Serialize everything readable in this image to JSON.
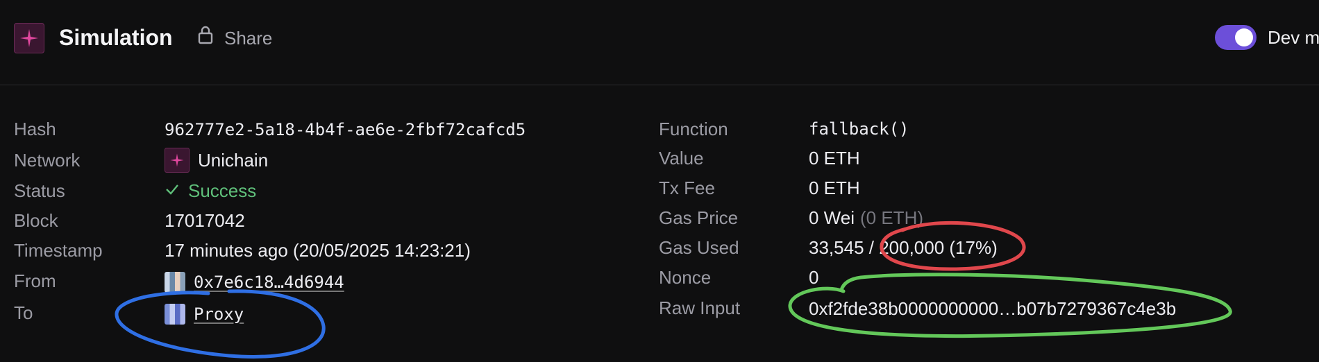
{
  "header": {
    "title": "Simulation",
    "share_label": "Share",
    "dev_mode_label": "Dev m",
    "dev_mode_on": true
  },
  "colors": {
    "accent": "#6c4fd9",
    "brand": "#e0479e",
    "success": "#5fbf7a",
    "annotation_blue": "#2f6fe4",
    "annotation_red": "#e0474c",
    "annotation_green": "#63c85a"
  },
  "left": {
    "hash": {
      "label": "Hash",
      "value": "962777e2-5a18-4b4f-ae6e-2fbf72cafcd5"
    },
    "network": {
      "label": "Network",
      "value": "Unichain"
    },
    "status": {
      "label": "Status",
      "icon": "check-icon",
      "value": "Success"
    },
    "block": {
      "label": "Block",
      "value": "17017042"
    },
    "timestamp": {
      "label": "Timestamp",
      "value": "17 minutes ago (20/05/2025 14:23:21)"
    },
    "from": {
      "label": "From",
      "value": "0x7e6c18…4d6944"
    },
    "to": {
      "label": "To",
      "value": "Proxy"
    }
  },
  "right": {
    "function": {
      "label": "Function",
      "value": "fallback()"
    },
    "value": {
      "label": "Value",
      "value": "0 ETH"
    },
    "tx_fee": {
      "label": "Tx Fee",
      "value": "0 ETH"
    },
    "gas_price": {
      "label": "Gas Price",
      "value": "0 Wei",
      "secondary": "(0 ETH)"
    },
    "gas_used": {
      "label": "Gas Used",
      "value": "33,545 / 200,000 (17%)"
    },
    "nonce": {
      "label": "Nonce",
      "value": "0"
    },
    "raw_input": {
      "label": "Raw Input",
      "value": "0xf2fde38b0000000000…b07b7279367c4e3b"
    }
  }
}
